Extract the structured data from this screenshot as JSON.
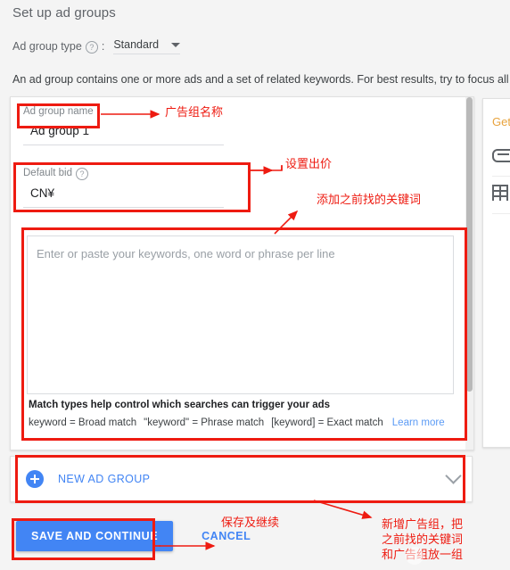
{
  "header": {
    "title": "Set up ad groups",
    "ad_group_type_label": "Ad group type",
    "help_icon": "help-circle-icon",
    "colon": ":",
    "ad_group_type_value": "Standard",
    "intro": "An ad group contains one or more ads and a set of related keywords. For best results, try to focus all the ads"
  },
  "form": {
    "ad_group_name_label": "Ad group name",
    "ad_group_name_value": "Ad group 1",
    "default_bid_label": "Default bid",
    "default_bid_value": "CN¥",
    "keywords_placeholder": "Enter or paste your keywords, one word or phrase per line",
    "keywords_value": "",
    "match_title": "Match types help control which searches can trigger your ads",
    "match_broad": "keyword = Broad match",
    "match_phrase": "\"keyword\" = Phrase match",
    "match_exact": "[keyword] = Exact match",
    "learn_more": "Learn more"
  },
  "new_group": {
    "label": "NEW AD GROUP",
    "plus_icon": "plus-circle-icon",
    "chevron_icon": "chevron-down-icon"
  },
  "actions": {
    "save_label": "SAVE AND CONTINUE",
    "cancel_label": "CANCEL"
  },
  "side_panel": {
    "title": "Get",
    "item_link_icon": "link-icon",
    "item_grid_icon": "grid-icon"
  },
  "annotations": {
    "ad_group_name": "广告组名称",
    "default_bid": "设置出价",
    "keywords": "添加之前找的关键词",
    "save": "保存及继续",
    "new_group_line1": "新增广告组，把",
    "new_group_line2": "之前找的关键词",
    "new_group_line3": "和广告组放一组"
  },
  "colors": {
    "accent_blue": "#4285f4",
    "annotation_red": "#ee1b11",
    "page_bg": "#f4f4f4",
    "card_bg": "#ffffff",
    "side_title": "#e8a33d"
  }
}
